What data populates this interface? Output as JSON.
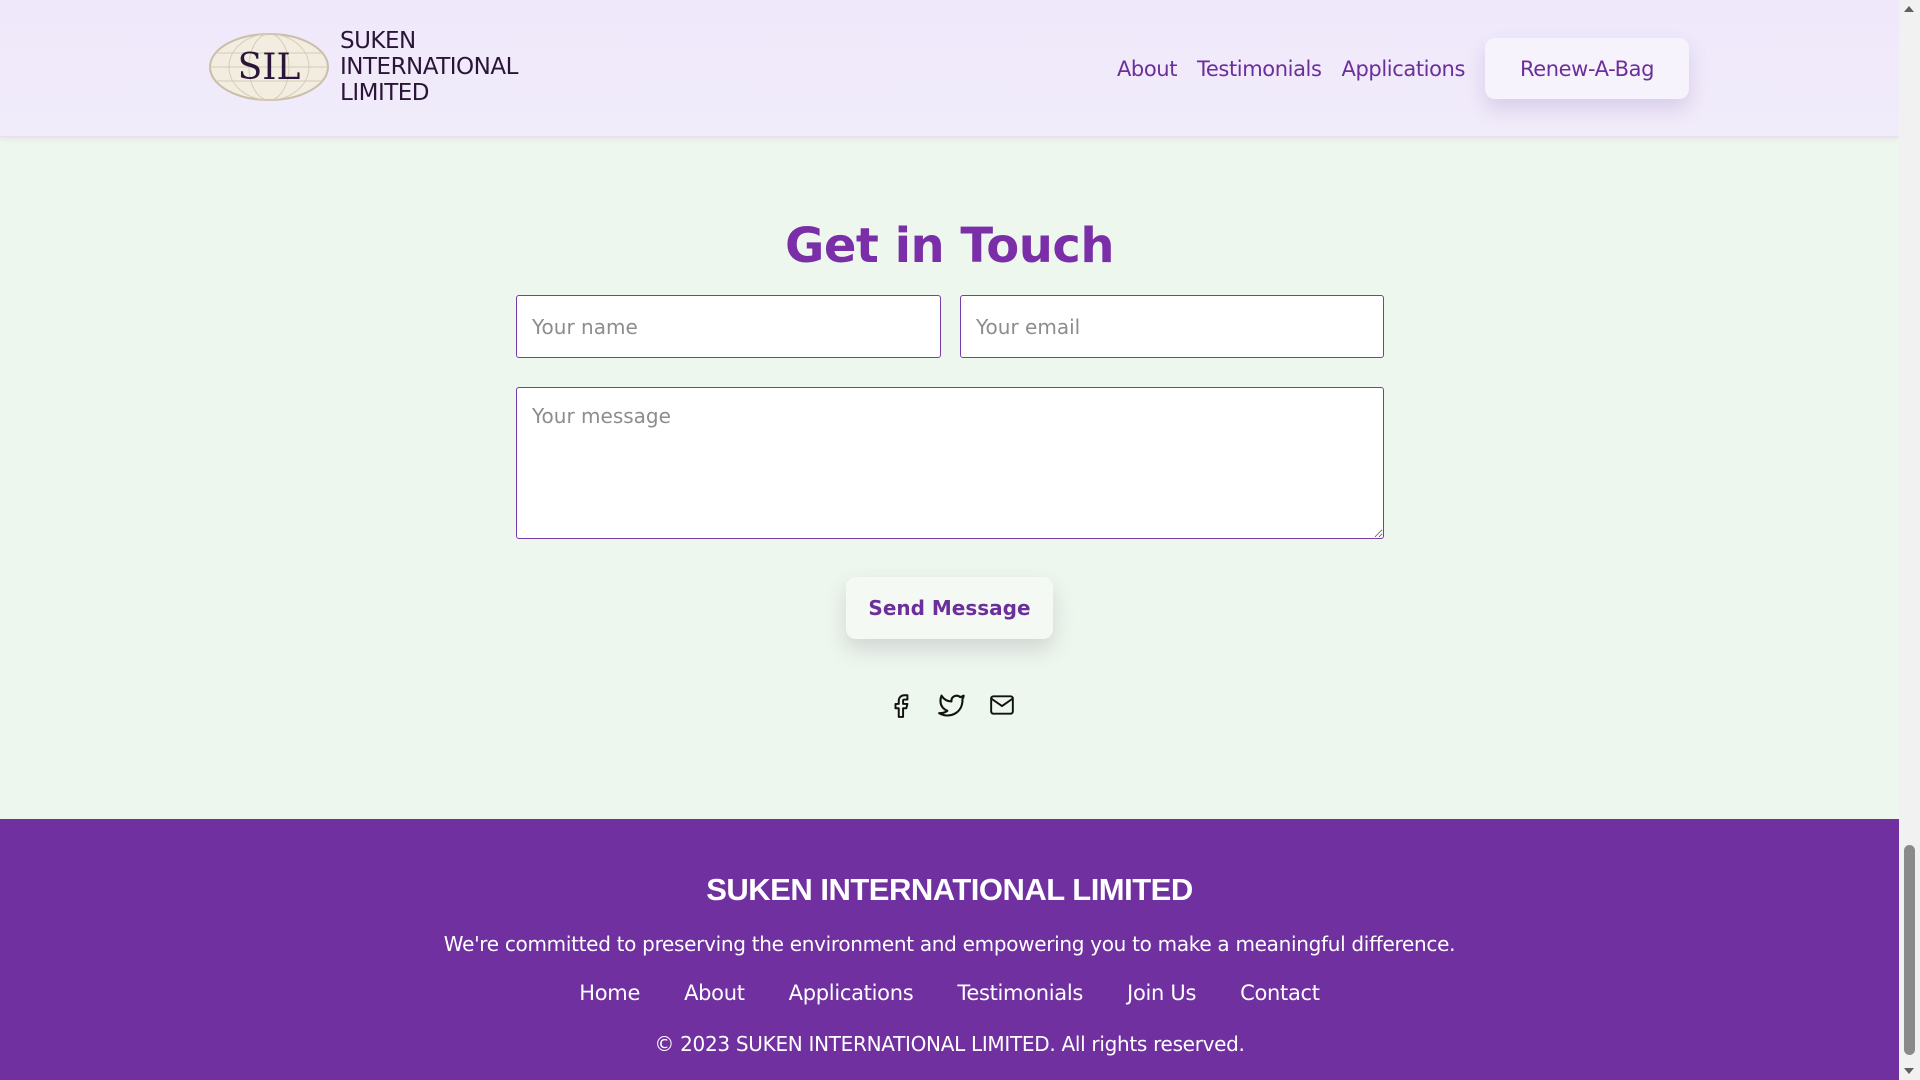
{
  "header": {
    "logo": {
      "emblem_text": "SIL",
      "lines": [
        "SUKEN",
        "INTERNATIONAL",
        "LIMITED"
      ]
    },
    "nav": [
      {
        "label": "About"
      },
      {
        "label": "Testimonials"
      },
      {
        "label": "Applications"
      }
    ],
    "cta_label": "Renew-A-Bag"
  },
  "contact": {
    "title": "Get in Touch",
    "name_placeholder": "Your name",
    "email_placeholder": "Your email",
    "message_placeholder": "Your message",
    "send_label": "Send Message",
    "socials": [
      "facebook-icon",
      "twitter-icon",
      "mail-icon"
    ]
  },
  "footer": {
    "title": "SUKEN INTERNATIONAL LIMITED",
    "tagline": "We're committed to preserving the environment and empowering you to make a meaningful difference.",
    "links": [
      {
        "label": "Home"
      },
      {
        "label": "About"
      },
      {
        "label": "Applications"
      },
      {
        "label": "Testimonials"
      },
      {
        "label": "Join Us"
      },
      {
        "label": "Contact"
      }
    ],
    "copyright": "© 2023 SUKEN INTERNATIONAL LIMITED. All rights reserved."
  },
  "colors": {
    "accent_purple": "#7030a0",
    "title_purple": "#7a2fa8",
    "header_bg": "#efe8fb",
    "section_bg": "#eef7ee"
  }
}
